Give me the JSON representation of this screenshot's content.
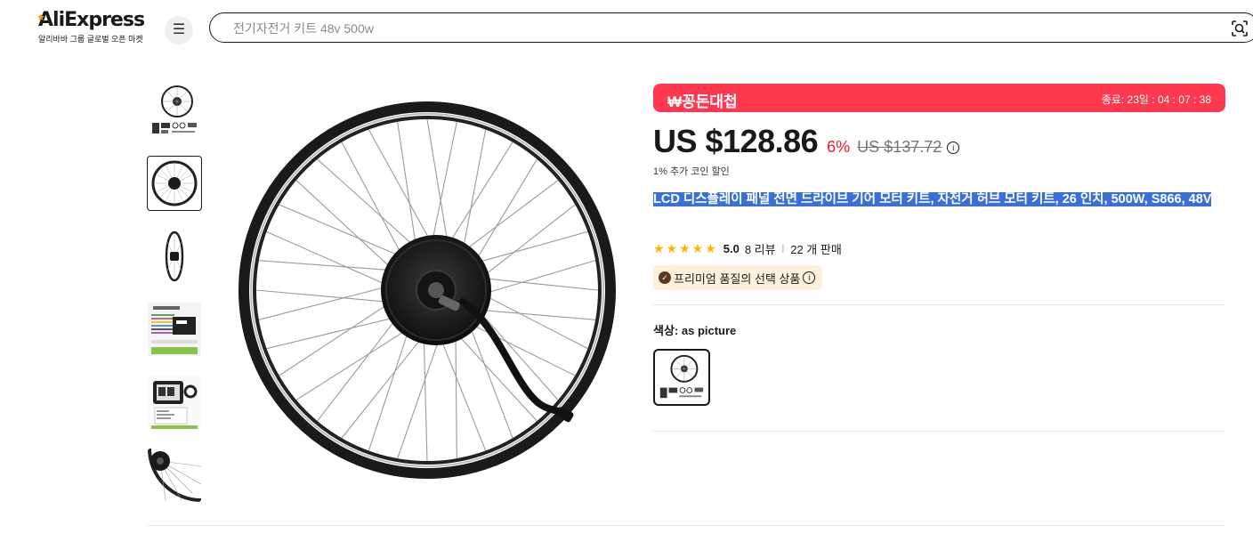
{
  "header": {
    "logo_text": "AliExpress",
    "logo_subtitle": "알리바바 그룹 글로벌 오픈 마켓",
    "menu_icon": "hamburger-icon",
    "search_placeholder": "전기자전거 키트 48v 500w",
    "search_icon": "image-search-icon"
  },
  "gallery": {
    "thumbnails": [
      {
        "name": "wheel-kit-set",
        "active": false
      },
      {
        "name": "wheel-front",
        "active": true
      },
      {
        "name": "wheel-side",
        "active": false
      },
      {
        "name": "controller",
        "active": false
      },
      {
        "name": "lcd-display",
        "active": false
      },
      {
        "name": "wheel-closeup",
        "active": false
      }
    ]
  },
  "promo": {
    "title": "₩꽁돈대첩",
    "timer": "종료: 23일 : 04 : 07 : 38",
    "color": "#fd384f"
  },
  "price": {
    "current": "US $128.86",
    "discount": "6%",
    "original": "US $137.72",
    "coin_note": "1% 추가 코인 할인"
  },
  "product": {
    "title": "LCD 디스플레이 패널 전면 드라이브 기어 모터 키트, 자전거 허브 모터 키트, 26 인치, 500W, S866, 48V",
    "rating": "5.0",
    "stars": 5,
    "reviews": "8 리뷰",
    "sold": "22 개 판매",
    "badge": "프리미엄 품질의 선택 상품"
  },
  "options": {
    "color_label": "색상:",
    "color_value": "as picture"
  },
  "colors": {
    "accent": "#fd384f",
    "discount": "#e5202b",
    "star": "#ffb400",
    "selection": "#3a6fd8"
  }
}
